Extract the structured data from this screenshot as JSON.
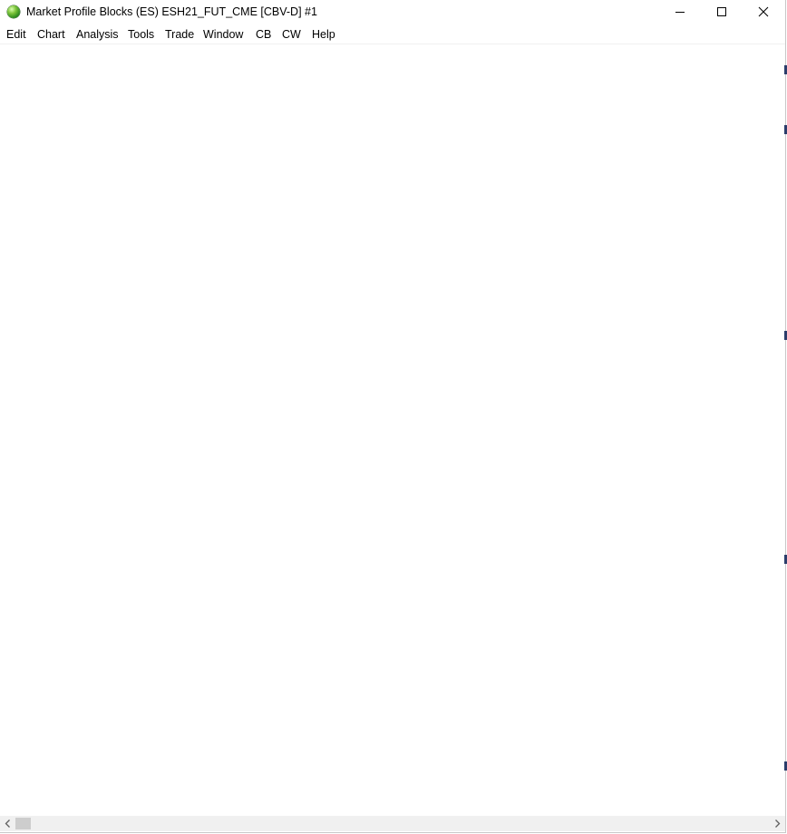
{
  "window": {
    "title": "Market Profile Blocks (ES) ESH21_FUT_CME [CBV-D]  #1",
    "icon": "globe-icon"
  },
  "menu": {
    "items": [
      {
        "label": "Edit"
      },
      {
        "label": "Chart"
      },
      {
        "label": "Analysis"
      },
      {
        "label": "Tools"
      },
      {
        "label": "Trade"
      },
      {
        "label": "Window"
      },
      {
        "label": "CB"
      },
      {
        "label": "CW"
      },
      {
        "label": "Help"
      }
    ]
  },
  "colors": {
    "background": "#ffffff",
    "scrollbar_track": "#f0f0f0",
    "scrollbar_thumb": "#cdcdcd"
  }
}
